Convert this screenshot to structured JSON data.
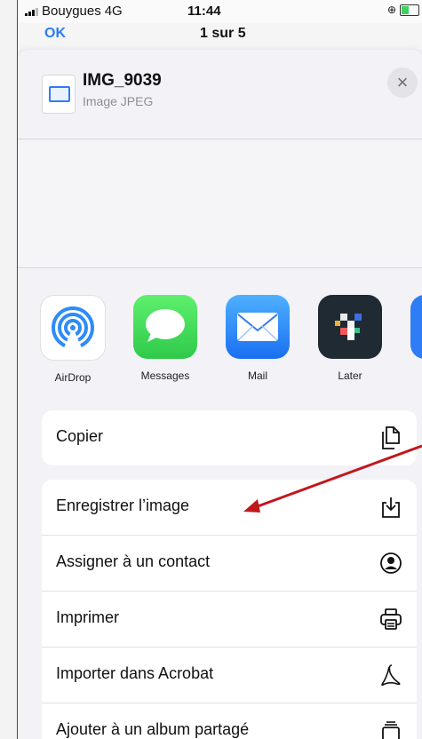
{
  "status_bar": {
    "carrier": "Bouygues",
    "network": "4G",
    "time": "11:44"
  },
  "behind": {
    "ok": "OK",
    "title": "1 sur 5"
  },
  "share_sheet": {
    "file_name": "IMG_9039",
    "file_type": "Image JPEG",
    "close_label": "×",
    "apps": [
      {
        "label": "AirDrop",
        "icon": "airdrop-icon"
      },
      {
        "label": "Messages",
        "icon": "messages-icon"
      },
      {
        "label": "Mail",
        "icon": "mail-icon"
      },
      {
        "label": "Later",
        "icon": "later-icon"
      }
    ],
    "actions_group1": [
      {
        "label": "Copier",
        "icon": "copy-icon"
      }
    ],
    "actions_group2": [
      {
        "label": "Enregistrer l’image",
        "icon": "save-image-icon"
      },
      {
        "label": "Assigner à un contact",
        "icon": "contact-icon"
      },
      {
        "label": "Imprimer",
        "icon": "print-icon"
      },
      {
        "label": "Importer dans Acrobat",
        "icon": "acrobat-icon"
      },
      {
        "label": "Ajouter à un album partagé",
        "icon": "shared-album-icon"
      }
    ]
  },
  "colors": {
    "accent": "#2b7cf6",
    "annotation_arrow": "#c0171b"
  }
}
